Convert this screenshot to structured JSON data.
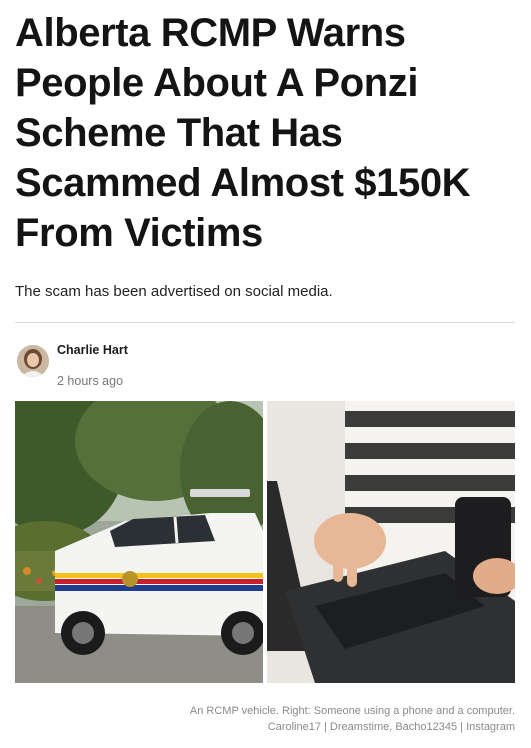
{
  "article": {
    "headline": "Alberta RCMP Warns People About A Ponzi Scheme That Has Scammed Almost $150K From Victims",
    "dek": "The scam has been advertised on social media.",
    "author": {
      "name": "Charlie Hart",
      "timestamp": "2 hours ago"
    },
    "image": {
      "caption_line1": "An RCMP vehicle. Right: Someone using a phone and a computer.",
      "caption_line2": "Caroline17 | Dreamstime, Bacho12345 | Instagram"
    }
  }
}
